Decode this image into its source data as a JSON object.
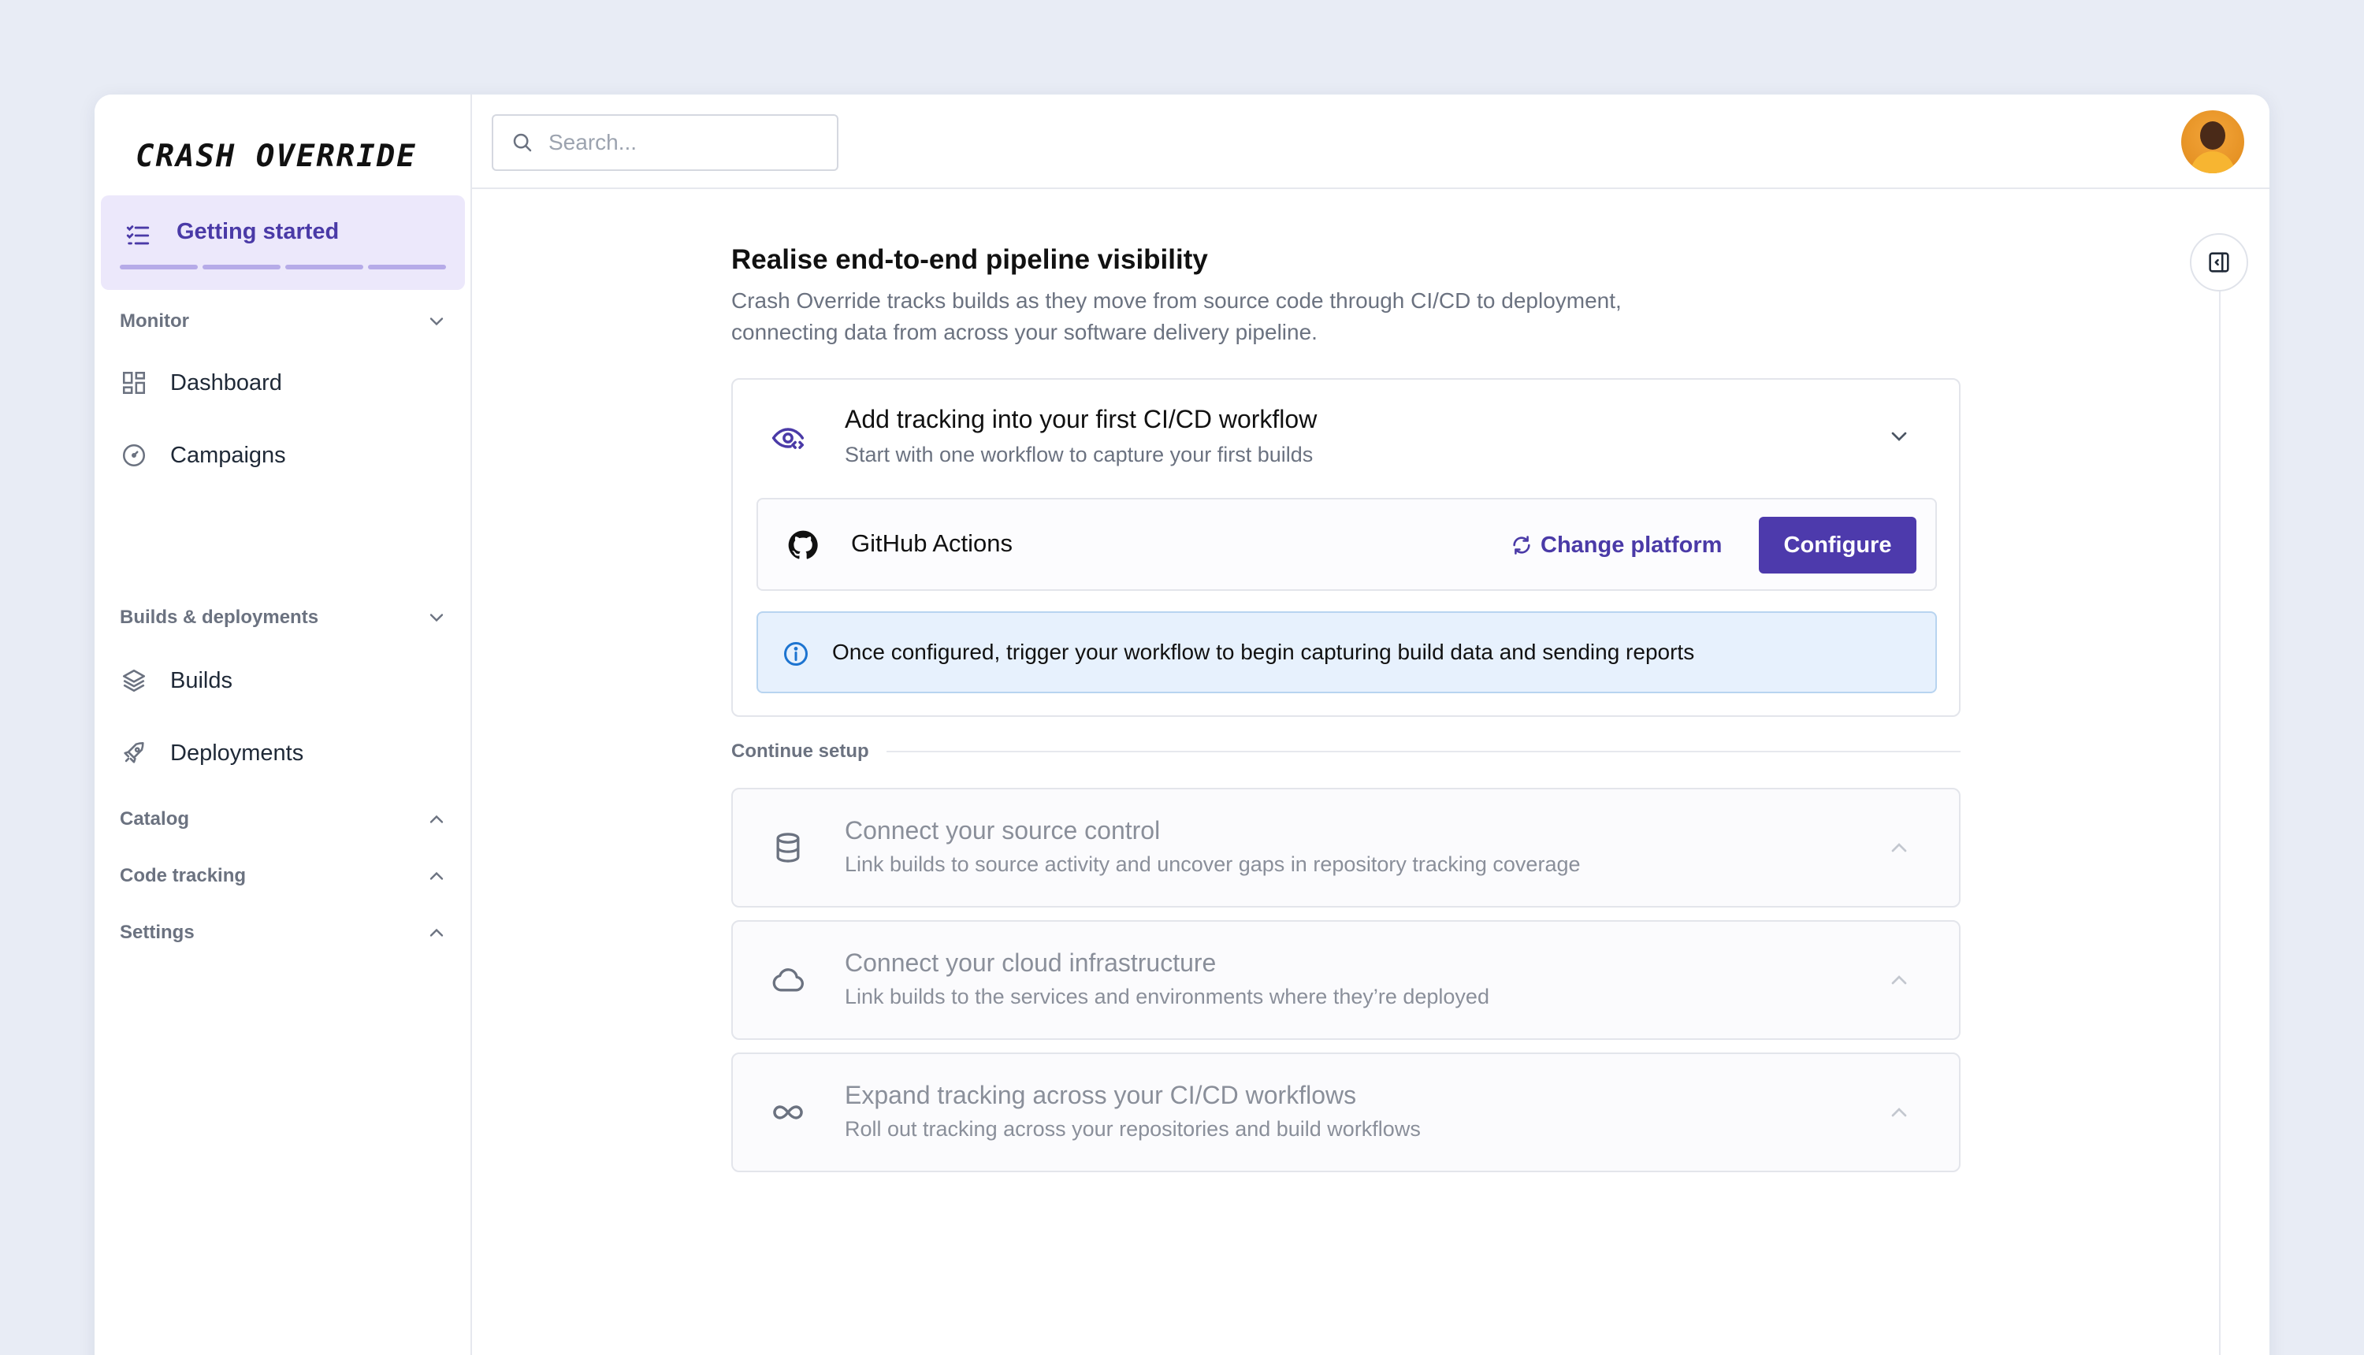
{
  "brand": {
    "name": "CRASH OVERRIDE"
  },
  "search": {
    "placeholder": "Search..."
  },
  "sidebar": {
    "getting_started": "Getting started",
    "progress_segments": 4,
    "sections": {
      "monitor": "Monitor",
      "builds_deployments": "Builds & deployments",
      "catalog": "Catalog",
      "code_tracking": "Code tracking",
      "settings": "Settings"
    },
    "items": {
      "dashboard": "Dashboard",
      "campaigns": "Campaigns",
      "builds": "Builds",
      "deployments": "Deployments"
    }
  },
  "main": {
    "title": "Realise end-to-end pipeline visibility",
    "description": "Crash Override tracks builds as they move from source code through CI/CD to deployment, connecting data from across your software delivery pipeline.",
    "active_step": {
      "title": "Add tracking into your first CI/CD workflow",
      "subtitle": "Start with one workflow to capture your first builds",
      "platform": "GitHub Actions",
      "change_platform": "Change platform",
      "configure": "Configure",
      "info": "Once configured, trigger your workflow to begin capturing build data and sending reports"
    },
    "continue_label": "Continue setup",
    "steps": [
      {
        "title": "Connect your source control",
        "subtitle": "Link builds to source activity and uncover gaps in repository tracking coverage",
        "icon": "database-icon"
      },
      {
        "title": "Connect your cloud infrastructure",
        "subtitle": "Link builds to the services and environments where they’re deployed",
        "icon": "cloud-icon"
      },
      {
        "title": "Expand tracking across your CI/CD workflows",
        "subtitle": "Roll out tracking across your repositories and build workflows",
        "icon": "infinity-icon"
      }
    ]
  },
  "colors": {
    "accent": "#4d3aac",
    "accent_bg": "#ece8fb",
    "info_bg": "#e7f1fd",
    "page_bg": "#e8ecf5"
  }
}
